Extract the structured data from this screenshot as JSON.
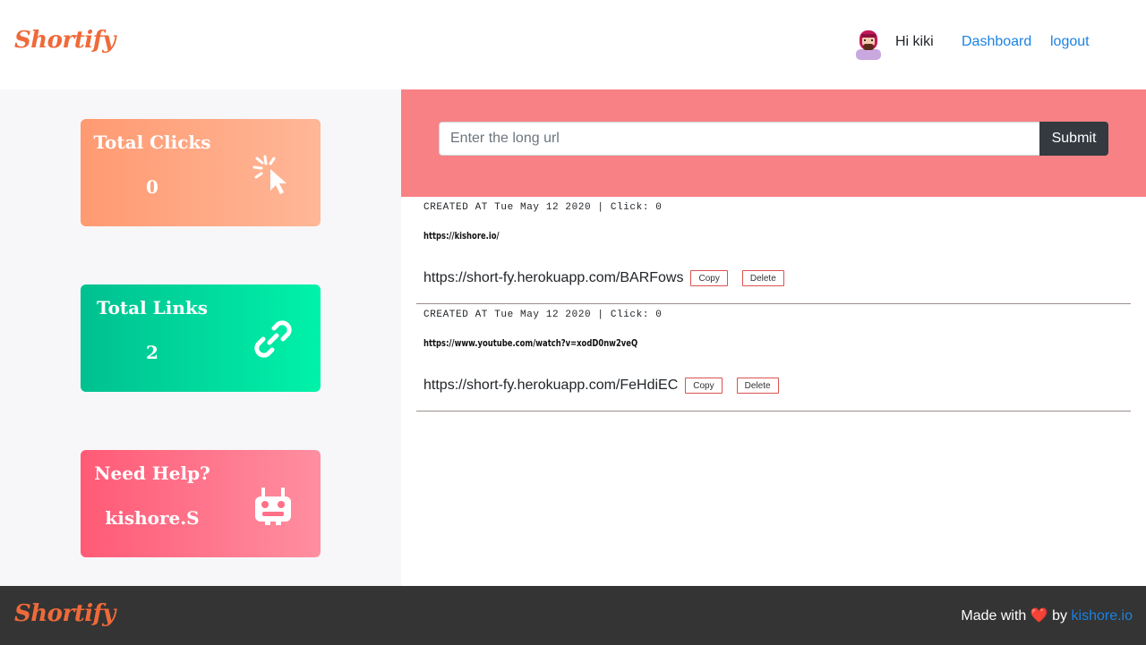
{
  "header": {
    "brand": "Shortify",
    "greeting": "Hi kiki",
    "nav": {
      "dashboard": "Dashboard",
      "logout": "logout"
    }
  },
  "stats": {
    "clicks": {
      "title": "Total Clicks",
      "value": "0",
      "icon": "cursor-click-icon"
    },
    "links": {
      "title": "Total Links",
      "value": "2",
      "icon": "link-icon"
    },
    "help": {
      "title": "Need Help?",
      "value": "kishore.S",
      "icon": "robot-icon"
    }
  },
  "shortener": {
    "placeholder": "Enter the long url",
    "value": "",
    "submit_label": "Submit"
  },
  "links": [
    {
      "meta": "CREATED AT Tue May 12 2020 | Click: 0",
      "long_url": "https://kishore.io/",
      "short_url": "https://short-fy.herokuapp.com/BARFows",
      "copy_label": "Copy",
      "delete_label": "Delete"
    },
    {
      "meta": "CREATED AT Tue May 12 2020 | Click: 0",
      "long_url": "https://www.youtube.com/watch?v=xodD0nw2veQ",
      "short_url": "https://short-fy.herokuapp.com/FeHdiEC",
      "copy_label": "Copy",
      "delete_label": "Delete"
    }
  ],
  "footer": {
    "brand": "Shortify",
    "made_with": "Made with",
    "heart": "❤️",
    "by": "by",
    "author_link": "kishore.io"
  },
  "colors": {
    "brand": "#ef6a3a",
    "link": "#1a82e2",
    "url_bar": "#f78185",
    "footer": "#343434"
  }
}
